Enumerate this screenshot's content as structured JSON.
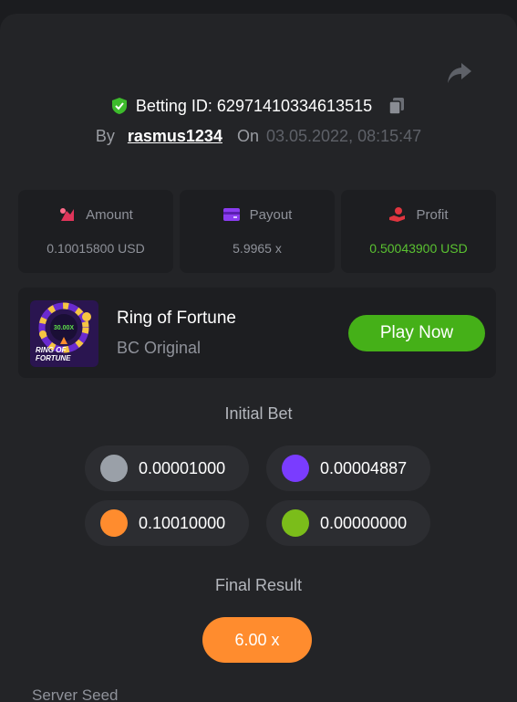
{
  "header": {
    "betting_id_label": "Betting ID: 62971410334613515",
    "by_label": "By",
    "username": "rasmus1234",
    "on_label": "On",
    "datetime": "03.05.2022, 08:15:47"
  },
  "stats": [
    {
      "label": "Amount",
      "value": "0.10015800 USD",
      "icon": "money-bag-icon"
    },
    {
      "label": "Payout",
      "value": "5.9965 x",
      "icon": "card-icon"
    },
    {
      "label": "Profit",
      "value": "0.50043900 USD",
      "icon": "hand-coin-icon"
    }
  ],
  "game": {
    "title": "Ring of Fortune",
    "subtitle": "BC Original",
    "thumb_multiplier": "30.00X",
    "thumb_text_1": "RING OF",
    "thumb_text_2": "FORTUNE",
    "play_label": "Play Now"
  },
  "initial_bet": {
    "label": "Initial Bet",
    "chips": [
      {
        "value": "0.00001000",
        "color": "#9aa0a8"
      },
      {
        "value": "0.00004887",
        "color": "#7a3cff"
      },
      {
        "value": "0.10010000",
        "color": "#ff8c2e"
      },
      {
        "value": "0.00000000",
        "color": "#7bbd1a"
      }
    ]
  },
  "final_result": {
    "label": "Final Result",
    "value": "6.00 x"
  },
  "server_seed": {
    "label": "Server Seed"
  },
  "colors": {
    "accent_green": "#45b018",
    "profit_green": "#5ac231",
    "result_orange": "#ff8c2e"
  }
}
